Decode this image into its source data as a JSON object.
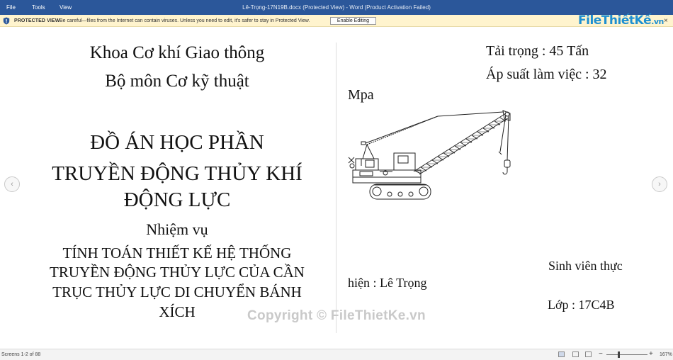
{
  "titlebar": {
    "menu": [
      "File",
      "Tools",
      "View"
    ],
    "title": "Lê-Trọng-17N19B.docx (Protected View) - Word (Product Activation Failed)"
  },
  "protected_view": {
    "label": "PROTECTED VIEW",
    "message": "Be careful—files from the Internet can contain viruses. Unless you need to edit, it's safer to stay in Protected View.",
    "button": "Enable Editing",
    "close": "×",
    "icon": "shield-icon"
  },
  "logo": {
    "name": "FileThiếtKế",
    "domain": ".vn"
  },
  "left_page": {
    "faculty": "Khoa Cơ khí Giao thông",
    "department": "Bộ môn Cơ kỹ thuật",
    "heading_1": "ĐỒ ÁN HỌC PHẦN",
    "heading_2": "TRUYỀN ĐỘNG THỦY KHÍ",
    "heading_3": "ĐỘNG LỰC",
    "task_label": "Nhiệm vụ",
    "task_lines": [
      "TÍNH TOÁN THIẾT KẾ HỆ THỐNG",
      "TRUYỀN ĐỘNG THỦY LỰC CỦA CẦN",
      "TRỤC THỦY LỰC DI CHUYỂN BÁNH",
      "XÍCH"
    ]
  },
  "right_page": {
    "load": "Tải trọng : 45 Tấn",
    "pressure": "Áp suất làm việc : 32",
    "pressure_unit": "Mpa",
    "student_label": "Sinh viên thực",
    "student_name": "hiện : Lê Trọng",
    "class": "Lớp : 17C4B"
  },
  "navigation": {
    "prev": "‹",
    "next": "›"
  },
  "watermark": "Copyright © FileThietKe.vn",
  "statusbar": {
    "pages": "Screens 1-2 of 88",
    "zoom_minus": "−",
    "zoom_plus": "+",
    "zoom": "167%",
    "zoom_fraction": 0.3
  }
}
